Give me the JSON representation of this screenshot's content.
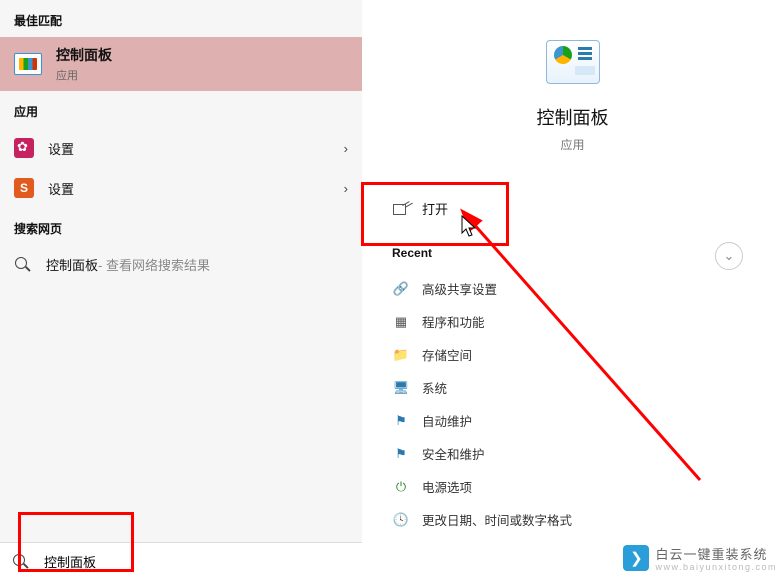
{
  "left": {
    "best_match_header": "最佳匹配",
    "best_match": {
      "title": "控制面板",
      "subtitle": "应用"
    },
    "apps_header": "应用",
    "apps": [
      {
        "label": "设置",
        "icon": "gear"
      },
      {
        "label": "设置",
        "icon": "sogou"
      }
    ],
    "web_header": "搜索网页",
    "web": {
      "main": "控制面板",
      "suffix": " - 查看网络搜索结果"
    }
  },
  "right": {
    "hero_title": "控制面板",
    "hero_sub": "应用",
    "open_label": "打开",
    "recent_header": "Recent",
    "recent": [
      {
        "label": "高级共享设置",
        "glyph": "🔗",
        "color": "#1a7a1a"
      },
      {
        "label": "程序和功能",
        "glyph": "▦",
        "color": "#555"
      },
      {
        "label": "存储空间",
        "glyph": "📁",
        "color": "#f5c851"
      },
      {
        "label": "系统",
        "glyph": "🖥",
        "color": "#2a7ab0"
      },
      {
        "label": "自动维护",
        "glyph": "⚑",
        "color": "#2a7ab0"
      },
      {
        "label": "安全和维护",
        "glyph": "⚑",
        "color": "#2a7ab0"
      },
      {
        "label": "电源选项",
        "glyph": "⏻",
        "color": "#2e8b2e"
      },
      {
        "label": "更改日期、时间或数字格式",
        "glyph": "🕓",
        "color": "#2a7ab0"
      }
    ]
  },
  "search": {
    "value": "控制面板"
  },
  "watermark": {
    "brand": "白云一键重装系统",
    "url": "www.baiyunxitong.com"
  }
}
